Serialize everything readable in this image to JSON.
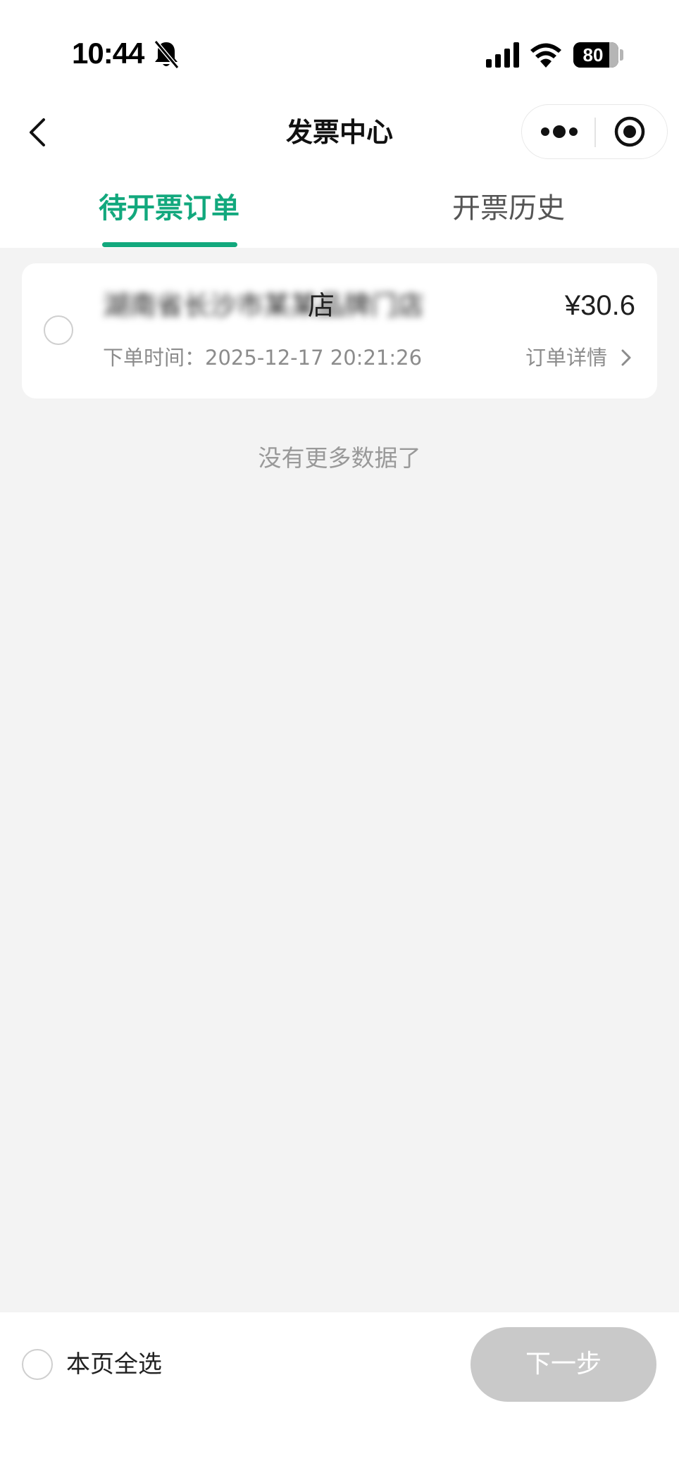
{
  "status_bar": {
    "time": "10:44",
    "battery_level": "80",
    "battery_percent": 80
  },
  "nav": {
    "title": "发票中心"
  },
  "tabs": [
    {
      "label": "待开票订单",
      "active": true
    },
    {
      "label": "开票历史",
      "active": false
    }
  ],
  "orders": [
    {
      "shop_name": "湖南省长沙市某某品牌门店",
      "shop_name_suffix": "店",
      "amount": "¥30.6",
      "time_label": "下单时间：",
      "time": "2025-12-17 20:21:26",
      "detail_label": "订单详情"
    }
  ],
  "list_end_text": "没有更多数据了",
  "bottom_bar": {
    "select_all_label": "本页全选",
    "next_label": "下一步"
  },
  "colors": {
    "accent": "#12a87d",
    "page_bg": "#f3f3f3",
    "disabled_button": "#c9c9c9"
  },
  "icons": {
    "back": "chevron-left-icon",
    "bell": "bell-off-icon",
    "more": "more-dots-icon",
    "close": "target-circle-icon",
    "detail": "chevron-right-icon"
  }
}
